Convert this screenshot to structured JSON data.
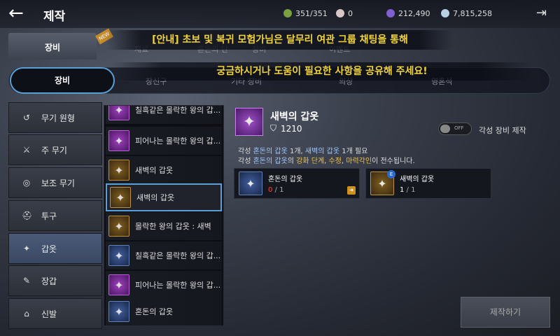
{
  "header": {
    "back_icon": "←",
    "title": "제작",
    "exit_icon": "⇥"
  },
  "resources": [
    {
      "icon": "stamina-icon",
      "color": "#7aa040",
      "value": "351/351"
    },
    {
      "icon": "pearl-icon",
      "color": "#d8c8c8",
      "value": "0"
    },
    {
      "icon": "blue-diamond-icon",
      "color": "#8060d0",
      "value": "212,490"
    },
    {
      "icon": "silver-icon",
      "color": "#b8d0e8",
      "value": "7,815,258"
    }
  ],
  "main_tab": {
    "label": "장비",
    "new_badge": "NEW"
  },
  "ghost_tabs": {
    "t1": "재료",
    "t2": "혼돈의 단",
    "t3": "장비",
    "t4": "이벤트"
  },
  "notice": {
    "line1": "[안내] 초보 및 복귀 모험가님은 달무리 여관 그룹 채팅을 통해",
    "line2": "궁금하시거나 도움이 필요한 사항을 공유해 주세요!"
  },
  "subtabs": {
    "active": "장비",
    "t2": "장신구",
    "t3": "기타 장비",
    "t4": "의상",
    "t5": "영혼석"
  },
  "categories": [
    {
      "label": "무기 원형",
      "icon": "↺"
    },
    {
      "label": "주 무기",
      "icon": "⚔"
    },
    {
      "label": "보조 무기",
      "icon": "◎"
    },
    {
      "label": "투구",
      "icon": "⛑"
    },
    {
      "label": "갑옷",
      "icon": "✦"
    },
    {
      "label": "장갑",
      "icon": "✎"
    },
    {
      "label": "신발",
      "icon": "⌂"
    }
  ],
  "items": [
    {
      "name": "칠흑같은 몰락한 왕의 갑...",
      "type": "purple"
    },
    {
      "name": "피어나는 몰락한 왕의 갑...",
      "type": "purple"
    },
    {
      "name": "새벽의 갑옷",
      "type": "gold"
    },
    {
      "name": "새벽의 갑옷",
      "type": "gold"
    },
    {
      "name": "몰락한 왕의 갑옷 : 새벽",
      "type": "gold"
    },
    {
      "name": "칠흑같은 몰락한 왕의 갑...",
      "type": "blue"
    },
    {
      "name": "피어나는 몰락한 왕의 갑...",
      "type": "purple"
    },
    {
      "name": "혼돈의 갑옷",
      "type": "blue"
    }
  ],
  "detail": {
    "name": "새벽의 갑옷",
    "power": "1210",
    "toggle": "OFF",
    "awaken_label": "각성 장비 제작",
    "desc1_a": "각성 ",
    "desc1_b": "혼돈의 갑옷",
    "desc1_c": " 1개, ",
    "desc1_d": "새벽의 갑옷",
    "desc1_e": " 1개 필요",
    "desc2_a": "각성 ",
    "desc2_b": "혼돈의 갑옷",
    "desc2_c": "의 ",
    "desc2_d": "강화 단계",
    "desc2_e": ", ",
    "desc2_f": "수정",
    "desc2_g": ", ",
    "desc2_h": "마력각인",
    "desc2_i": "이 전수됩니다."
  },
  "materials": [
    {
      "name": "혼돈의 갑옷",
      "have": "0",
      "need": "1"
    },
    {
      "name": "새벽의 갑옷",
      "have": "1",
      "need": "1",
      "badge": "E"
    }
  ],
  "craft_button": "제작하기"
}
